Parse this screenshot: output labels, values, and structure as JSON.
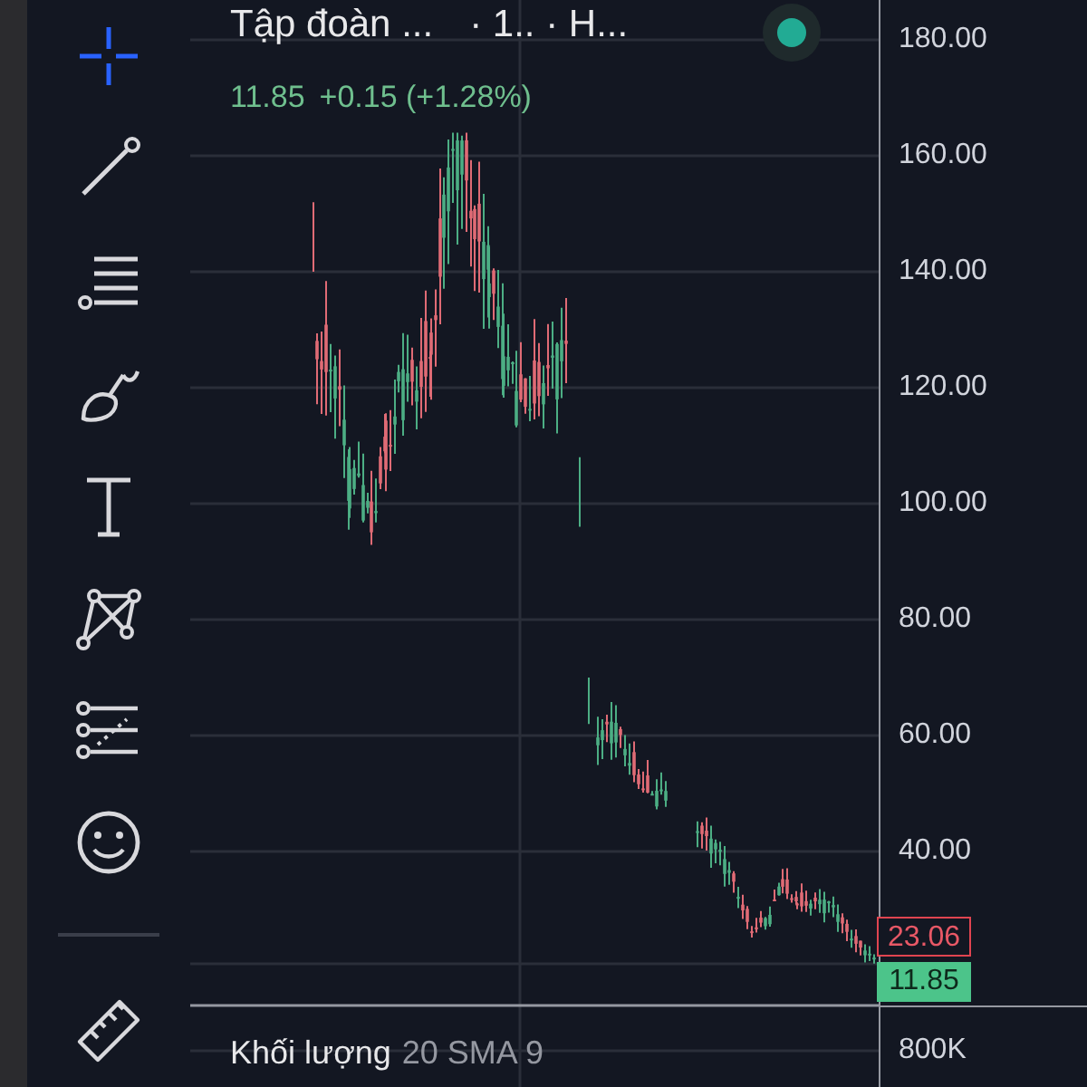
{
  "toolbar": {
    "tools": [
      {
        "kind": "crosshair",
        "selected": true
      },
      {
        "kind": "trend-line",
        "selected": false
      },
      {
        "kind": "fib",
        "selected": false
      },
      {
        "kind": "brush",
        "selected": false
      },
      {
        "kind": "text",
        "selected": false
      },
      {
        "kind": "pattern",
        "selected": false
      },
      {
        "kind": "projection",
        "selected": false
      },
      {
        "kind": "emoji",
        "selected": false
      },
      {
        "kind": "ruler",
        "selected": false
      }
    ]
  },
  "legend": {
    "symbol": "Tập đoàn ...",
    "details": "· 1.. · H...",
    "last": "11.85",
    "change": "+0.15 (+1.28%)"
  },
  "price_axis": {
    "ticks": [
      "180.00",
      "160.00",
      "140.00",
      "120.00",
      "100.00",
      "80.00",
      "60.00",
      "40.00"
    ],
    "badges": [
      {
        "kind": "high",
        "text": "23.06"
      },
      {
        "kind": "last",
        "text": "11.85"
      }
    ]
  },
  "volume_pane": {
    "title": "Khối lượng",
    "params": "20 SMA 9",
    "axis_label": "800K"
  }
}
